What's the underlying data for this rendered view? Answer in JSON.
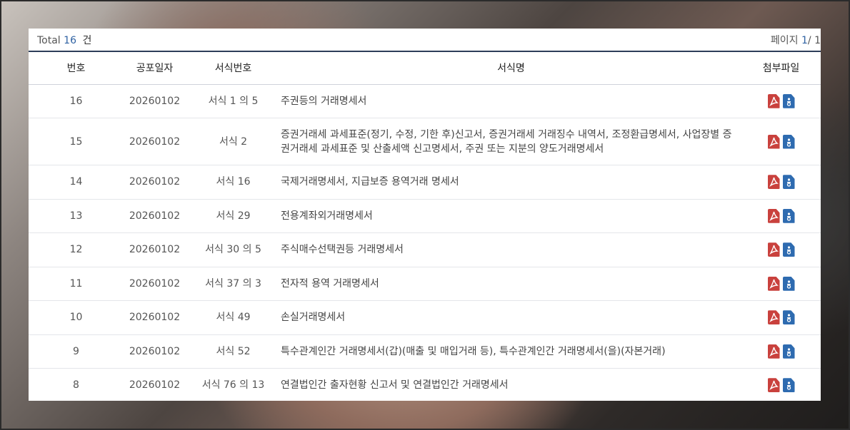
{
  "summary": {
    "total_label": "Total",
    "total_count": "16",
    "total_unit": "건"
  },
  "pager": {
    "label": "페이지",
    "current": "1",
    "separator": "/",
    "total": "1"
  },
  "columns": {
    "no": "번호",
    "date": "공포일자",
    "form_no": "서식번호",
    "form_name": "서식명",
    "attachments": "첨부파일"
  },
  "rows": [
    {
      "no": "16",
      "date": "20260102",
      "form_no": "서식 1 의 5",
      "title": "주권등의 거래명세서"
    },
    {
      "no": "15",
      "date": "20260102",
      "form_no": "서식 2",
      "title": "증권거래세 과세표준(정기, 수정, 기한 후)신고서, 증권거래세 거래징수 내역서, 조정환급명세서, 사업장별 증권거래세 과세표준 및 산출세액 신고명세서, 주권 또는 지분의 양도거래명세서"
    },
    {
      "no": "14",
      "date": "20260102",
      "form_no": "서식 16",
      "title": "국제거래명세서, 지급보증 용역거래 명세서"
    },
    {
      "no": "13",
      "date": "20260102",
      "form_no": "서식 29",
      "title": "전용계좌외거래명세서"
    },
    {
      "no": "12",
      "date": "20260102",
      "form_no": "서식 30 의 5",
      "title": "주식매수선택권등 거래명세서"
    },
    {
      "no": "11",
      "date": "20260102",
      "form_no": "서식 37 의 3",
      "title": "전자적 용역 거래명세서"
    },
    {
      "no": "10",
      "date": "20260102",
      "form_no": "서식 49",
      "title": "손실거래명세서"
    },
    {
      "no": "9",
      "date": "20260102",
      "form_no": "서식 52",
      "title": "특수관계인간 거래명세서(갑)(매출 및 매입거래 등), 특수관계인간 거래명세서(을)(자본거래)"
    },
    {
      "no": "8",
      "date": "20260102",
      "form_no": "서식 76 의 13",
      "title": "연결법인간 출자현황 신고서 및 연결법인간 거래명세서"
    }
  ],
  "icons": {
    "pdf": "pdf-file-icon",
    "hwp": "hwp-file-icon",
    "pdf_color": "#c9413d",
    "hwp_color": "#2e6bb0",
    "accent": "#2f62a3"
  }
}
